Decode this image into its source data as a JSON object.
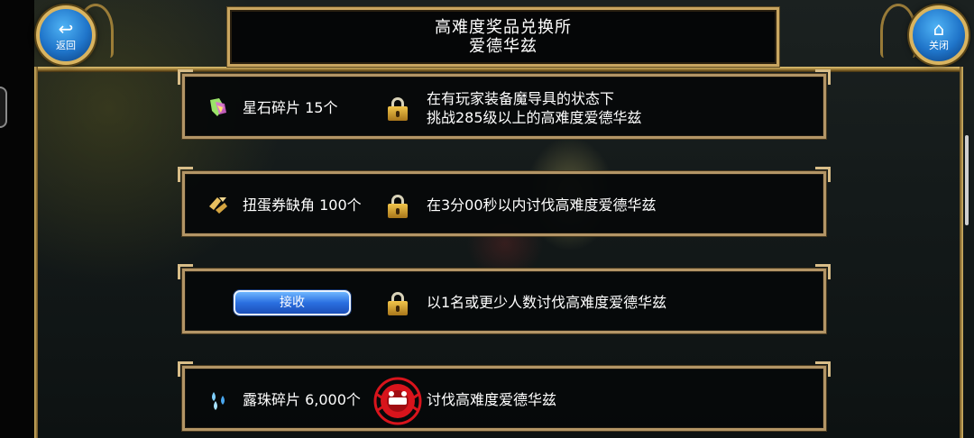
{
  "header": {
    "title_line1": "高难度奖品兑换所",
    "title_line2": "爱德华兹"
  },
  "back_button": {
    "label": "返回",
    "icon": "back-arrow-icon"
  },
  "close_button": {
    "label": "关闭",
    "icon": "home-icon"
  },
  "rows": [
    {
      "reward": "星石碎片 15个",
      "icon": "star-stone-icon",
      "status": "locked",
      "condition_line1": "在有玩家装备魔导具的状态下",
      "condition_line2": "挑战285级以上的高难度爱德华兹"
    },
    {
      "reward": "扭蛋券缺角 100个",
      "icon": "gacha-ticket-icon",
      "status": "locked",
      "condition_line1": "在3分00秒以内讨伐高难度爱德华兹"
    },
    {
      "button_label": "接收",
      "status": "locked",
      "condition_line1": "以1名或更少人数讨伐高难度爱德华兹"
    },
    {
      "reward": "露珠碎片 6,000个",
      "icon": "dew-drop-icon",
      "status": "cleared",
      "condition_line1": "讨伐高难度爱德华兹"
    }
  ],
  "colors": {
    "frame_gold": "#c9a661",
    "button_blue": "#2a6fe0",
    "emblem_red": "#d8141c"
  }
}
